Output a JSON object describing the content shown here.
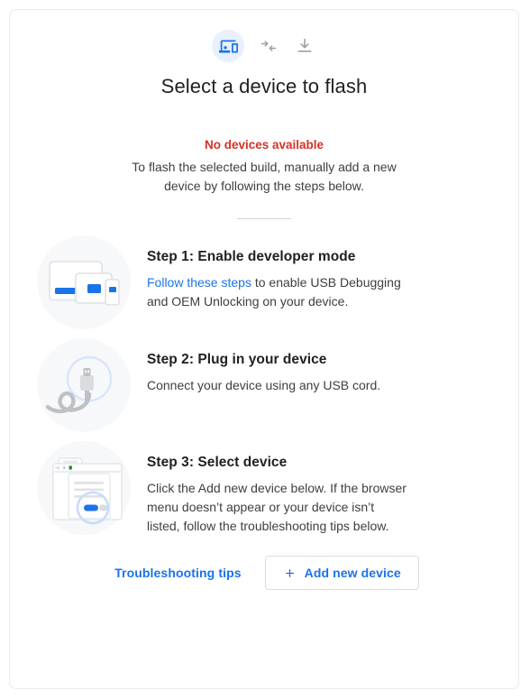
{
  "header": {
    "icons": [
      {
        "name": "devices-icon",
        "state": "active",
        "color": "#1a73e8",
        "chip_color": "#e8f0fe"
      },
      {
        "name": "connect-arrows-icon",
        "state": "inactive",
        "color": "#9aa0a6"
      },
      {
        "name": "download-icon",
        "state": "inactive",
        "color": "#9aa0a6"
      }
    ],
    "title": "Select a device to flash"
  },
  "status": {
    "error_text": "No devices available",
    "error_color": "#d93025",
    "description": "To flash the selected build, manually add a new device by following the steps below."
  },
  "steps": [
    {
      "art": "devices-illustration",
      "title": "Step 1: Enable developer mode",
      "link_text": "Follow these steps",
      "desc_after_link": " to enable USB Debugging and OEM Unlocking on your device."
    },
    {
      "art": "usb-cable-illustration",
      "title": "Step 2: Plug in your device",
      "description": "Connect your device using any USB cord."
    },
    {
      "art": "browser-dialog-illustration",
      "title": "Step 3: Select device",
      "description": "Click the Add new device below. If the browser menu doesn’t appear or your device isn’t listed, follow the troubleshooting tips below."
    }
  ],
  "actions": {
    "troubleshooting_label": "Troubleshooting tips",
    "add_device_label": "Add new device",
    "add_device_icon": "plus-icon",
    "accent_color": "#1a73e8"
  }
}
